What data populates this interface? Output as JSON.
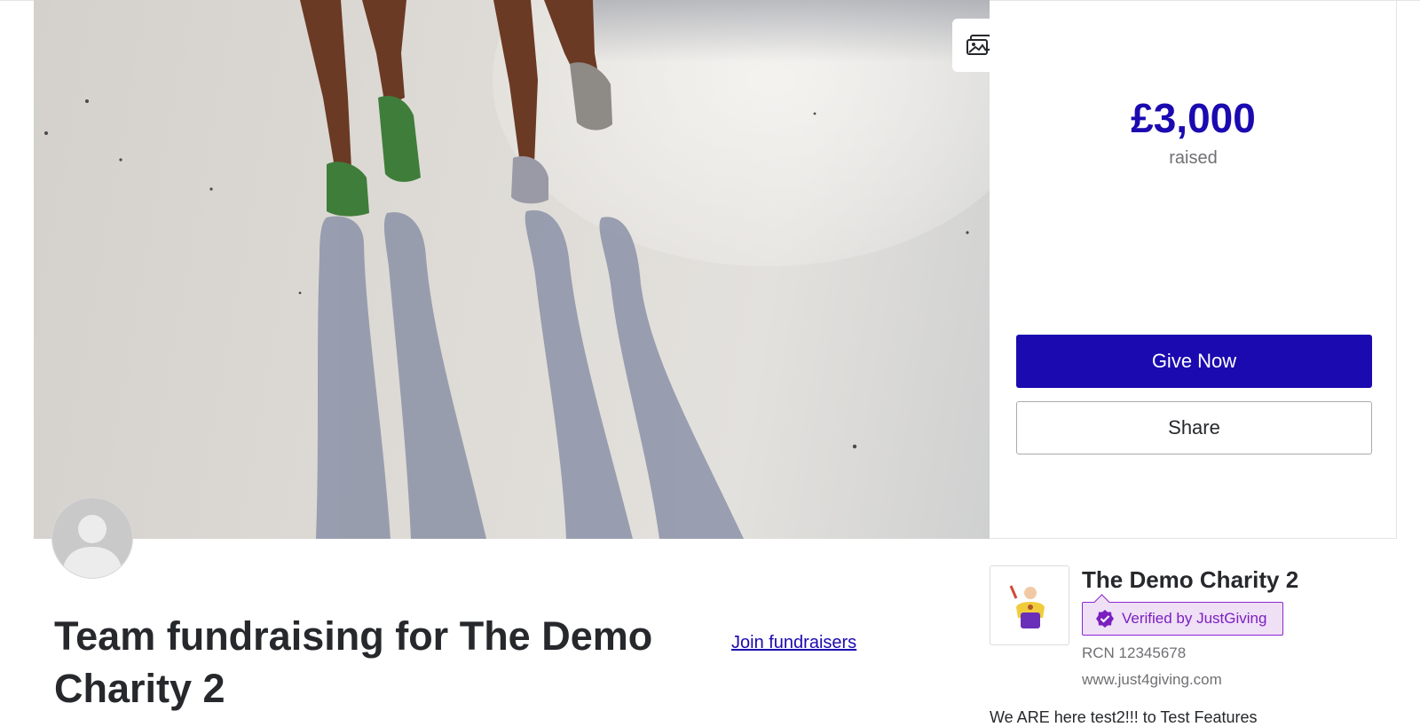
{
  "hero": {
    "image_description_icon": "gallery-icon"
  },
  "donation": {
    "amount": "£3,000",
    "raised_label": "raised",
    "give_button": "Give Now",
    "share_button": "Share",
    "accent_color": "#1b0ab0"
  },
  "page": {
    "title": "Team fundraising for The Demo Charity 2",
    "join_link": "Join fundraisers"
  },
  "charity": {
    "name": "The Demo Charity 2",
    "verified_label": "Verified by JustGiving",
    "registration": "RCN 12345678",
    "website": "www.just4giving.com",
    "description": "We ARE here test2!!! to Test Features",
    "verified_color": "#8b27d1"
  }
}
